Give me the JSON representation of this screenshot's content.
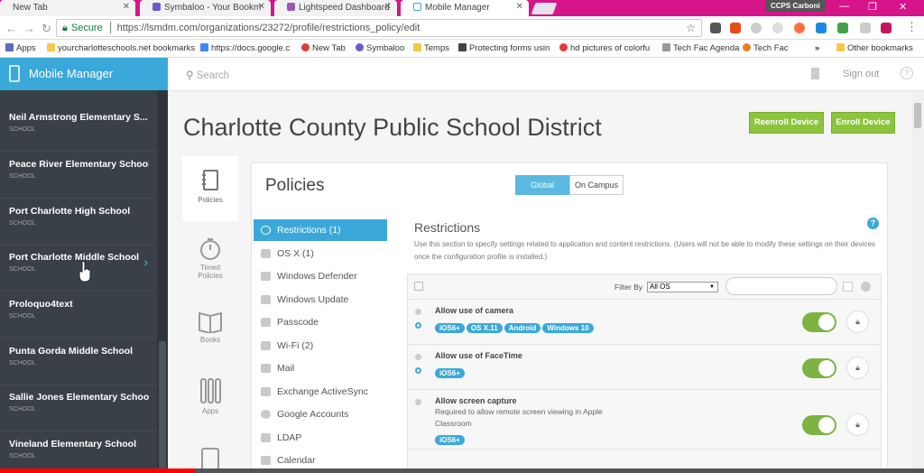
{
  "browser": {
    "tabs": [
      {
        "label": "New Tab"
      },
      {
        "label": "Symbaloo - Your Bookm"
      },
      {
        "label": "Lightspeed Dashboard"
      },
      {
        "label": "Mobile Manager"
      }
    ],
    "profile": "CCPS Carboni",
    "url_secure": "Secure",
    "url": "https://lsmdm.com/organizations/23272/profile/restrictions_policy/edit",
    "bookmarks": [
      {
        "label": "Apps"
      },
      {
        "label": "yourcharlotteschools.net bookmarks"
      },
      {
        "label": "https://docs.google.c"
      },
      {
        "label": "New Tab"
      },
      {
        "label": "Symbaloo"
      },
      {
        "label": "Temps"
      },
      {
        "label": "Protecting forms usin"
      },
      {
        "label": "hd pictures of colorfu"
      },
      {
        "label": "Tech Fac Agenda"
      },
      {
        "label": "Tech Fac"
      },
      {
        "label": "»"
      },
      {
        "label": "Other bookmarks"
      }
    ]
  },
  "sidebar": {
    "title": "Mobile Manager",
    "items": [
      {
        "name": "Neil Armstrong Elementary S...",
        "type": "SCHOOL"
      },
      {
        "name": "Peace River Elementary School",
        "type": "SCHOOL"
      },
      {
        "name": "Port Charlotte High School",
        "type": "SCHOOL"
      },
      {
        "name": "Port Charlotte Middle School",
        "type": "SCHOOL"
      },
      {
        "name": "Proloquo4text",
        "type": "SCHOOL"
      },
      {
        "name": "Punta Gorda Middle School",
        "type": "SCHOOL"
      },
      {
        "name": "Sallie Jones Elementary School",
        "type": "SCHOOL"
      },
      {
        "name": "Vineland Elementary School",
        "type": "SCHOOL"
      }
    ]
  },
  "topbar": {
    "search_placeholder": "Search",
    "sign_out": "Sign out",
    "help": "?"
  },
  "page": {
    "title": "Charlotte County Public School District",
    "reenroll": "Reenroll Device",
    "enroll": "Enroll Device"
  },
  "iconnav": [
    {
      "label": "Policies"
    },
    {
      "label": "Timed Policies"
    },
    {
      "label": "Books"
    },
    {
      "label": "Apps"
    }
  ],
  "policies": {
    "title": "Policies",
    "scope_global": "Global",
    "scope_campus": "On Campus",
    "menu": [
      {
        "label": "Restrictions (1)"
      },
      {
        "label": "OS X (1)"
      },
      {
        "label": "Windows Defender"
      },
      {
        "label": "Windows Update"
      },
      {
        "label": "Passcode"
      },
      {
        "label": "Wi-Fi (2)"
      },
      {
        "label": "Mail"
      },
      {
        "label": "Exchange ActiveSync"
      },
      {
        "label": "Google Accounts"
      },
      {
        "label": "LDAP"
      },
      {
        "label": "Calendar"
      }
    ]
  },
  "restrictions": {
    "title": "Restrictions",
    "description": "Use this section to specify settings related to application and content restrictions. (Users will not be able to modify these settings on their devices once the configuration profile is installed.)",
    "filter_label": "Filter By",
    "filter_value": "All OS",
    "rows": [
      {
        "name": "Allow use of camera",
        "desc": "",
        "sub": "",
        "badges": [
          "iOS6+",
          "OS X.11",
          "Android",
          "Windows 10"
        ],
        "enabled": true
      },
      {
        "name": "Allow use of FaceTime",
        "desc": "",
        "sub": "",
        "badges": [
          "iOS6+"
        ],
        "enabled": true
      },
      {
        "name": "Allow screen capture",
        "desc": "Required to allow remote screen viewing in Apple",
        "sub": "Classroom",
        "badges": [
          "iOS6+"
        ],
        "enabled": true
      }
    ]
  },
  "colors": {
    "accent": "#3aa9d9",
    "green": "#8cc43c",
    "sidebar": "#3a4047",
    "chrome": "#d7148a"
  }
}
